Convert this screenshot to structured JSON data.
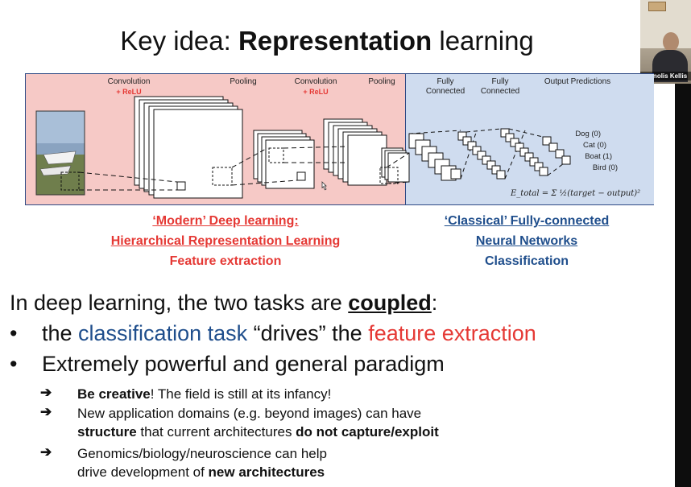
{
  "slide": {
    "title_part1": "Key idea: ",
    "title_bold": "Representation",
    "title_part2": " learning",
    "diagram": {
      "labels": {
        "conv1": "Convolution",
        "conv1_relu": "+ ReLU",
        "pool1": "Pooling",
        "conv2": "Convolution",
        "conv2_relu": "+ ReLU",
        "pool2": "Pooling",
        "fc1_line1": "Fully",
        "fc1_line2": "Connected",
        "fc2_line1": "Fully",
        "fc2_line2": "Connected",
        "output": "Output Predictions"
      },
      "outputs": [
        "Dog (0)",
        "Cat (0)",
        "Boat (1)",
        "Bird (0)"
      ],
      "formula": "E_total = Σ ½(target − output)²"
    },
    "caption_left": {
      "line1": "‘Modern’ Deep learning:",
      "line2": "Hierarchical Representation Learning",
      "line3": "Feature extraction"
    },
    "caption_right": {
      "line1": "‘Classical’ Fully-connected",
      "line2": "Neural Networks",
      "line3": "Classification"
    },
    "main_text": "In deep learning, the two tasks are ",
    "main_bold": "coupled",
    "main_end": ":",
    "bullets": {
      "b1_pre": "the ",
      "b1_blue": "classification task",
      "b1_mid": " “drives” the ",
      "b1_red": "feature extraction",
      "b2": "Extremely powerful and general paradigm"
    },
    "subs": {
      "s1_bold": "Be creative",
      "s1_rest": "! The field is still at its infancy!",
      "s2_line1": "New application domains (e.g. beyond images) can have",
      "s2_bold1": "structure",
      "s2_mid": " that current architectures ",
      "s2_bold2": "do not capture/exploit",
      "s3_line1": "Genomics/biology/neuroscience can help",
      "s3_pre": "drive development of ",
      "s3_bold": "new architectures"
    },
    "bullet_glyph": "•",
    "arrow_glyph": "➔"
  },
  "webcam": {
    "name": "Manolis Kellis"
  },
  "colors": {
    "accent_red": "#e53935",
    "accent_blue": "#1f4e8c",
    "panel_pink": "#f6c9c6",
    "panel_blue": "#cfdcef"
  }
}
